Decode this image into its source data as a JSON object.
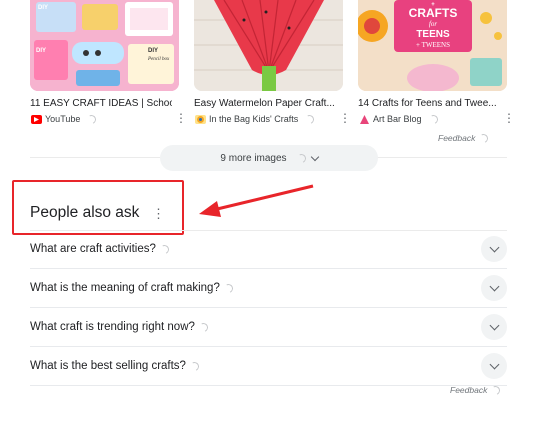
{
  "image_cards": [
    {
      "title": "11 EASY CRAFT IDEAS | Schoo...",
      "source": "YouTube",
      "thumb_lettering": [
        "DIY",
        "DIY",
        "DIY",
        "Pencil box"
      ]
    },
    {
      "title": "Easy Watermelon Paper Craft...",
      "source": "In the Bag Kids' Crafts"
    },
    {
      "title": "14 Crafts for Teens and Twee...",
      "source": "Art Bar Blog",
      "thumb_lettering": [
        "CRAFTS",
        "for",
        "TEENS",
        "+",
        "TWEENS"
      ]
    }
  ],
  "feedback_label": "Feedback",
  "more_images_label": "9 more images",
  "people_also_ask": {
    "title": "People also ask",
    "questions": [
      "What are craft activities?",
      "What is the meaning of craft making?",
      "What craft is trending right now?",
      "What is the best selling crafts?"
    ]
  },
  "colors": {
    "annotation_red": "#e8252a",
    "youtube_red": "#ff0000",
    "chip_bg": "#f1f3f4"
  },
  "icons": [
    "youtube-icon",
    "in-the-bag-icon",
    "art-bar-icon",
    "more-vert-icon",
    "chevron-down-icon",
    "loading-spinner-icon",
    "annotation-arrow"
  ]
}
